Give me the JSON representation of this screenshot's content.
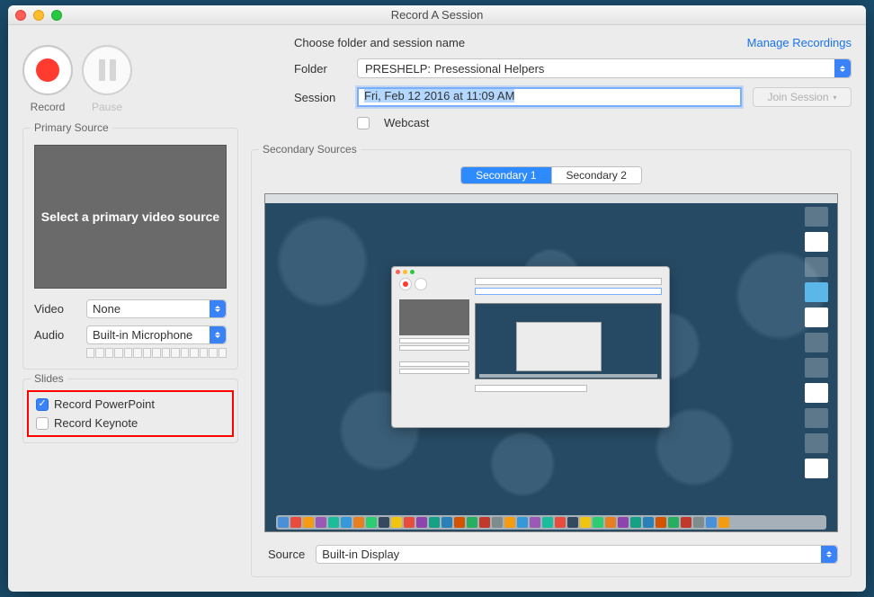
{
  "window_title": "Record A Session",
  "controls": {
    "record_label": "Record",
    "pause_label": "Pause"
  },
  "header": {
    "instruction": "Choose folder and session name",
    "manage_link": "Manage Recordings"
  },
  "folder_row": {
    "label": "Folder",
    "value": "PRESHELP: Presessional Helpers"
  },
  "session_row": {
    "label": "Session",
    "value": "Fri, Feb 12 2016 at 11:09 AM",
    "join_button": "Join Session"
  },
  "webcast": {
    "label": "Webcast",
    "checked": false
  },
  "primary": {
    "legend": "Primary Source",
    "placeholder": "Select a primary video source",
    "video_label": "Video",
    "video_value": "None",
    "audio_label": "Audio",
    "audio_value": "Built-in Microphone"
  },
  "slides": {
    "legend": "Slides",
    "powerpoint_label": "Record PowerPoint",
    "powerpoint_checked": true,
    "keynote_label": "Record Keynote",
    "keynote_checked": false
  },
  "secondary": {
    "legend": "Secondary Sources",
    "tab1": "Secondary 1",
    "tab2": "Secondary 2",
    "source_label": "Source",
    "source_value": "Built-in Display"
  }
}
